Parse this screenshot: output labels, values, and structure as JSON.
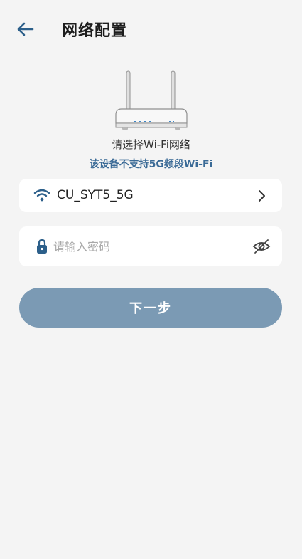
{
  "header": {
    "title": "网络配置",
    "back_icon": "arrow-left-icon"
  },
  "illustration": {
    "icon": "router-icon"
  },
  "subtitle": "请选择Wi-Fi网络",
  "warning": "该设备不支持5G频段Wi-Fi",
  "wifi": {
    "icon": "wifi-icon",
    "name": "CU_SYT5_5G",
    "chevron_icon": "chevron-right-icon"
  },
  "password": {
    "icon": "lock-icon",
    "value": "",
    "placeholder": "请输入密码",
    "visibility_icon": "eye-off-icon"
  },
  "next_button": {
    "label": "下一步"
  },
  "colors": {
    "background": "#f4f4f4",
    "card": "#ffffff",
    "accent": "#2c5f8a",
    "warning_text": "#3a6a96",
    "button": "#7b9ab4",
    "placeholder": "#a8a8a8"
  }
}
